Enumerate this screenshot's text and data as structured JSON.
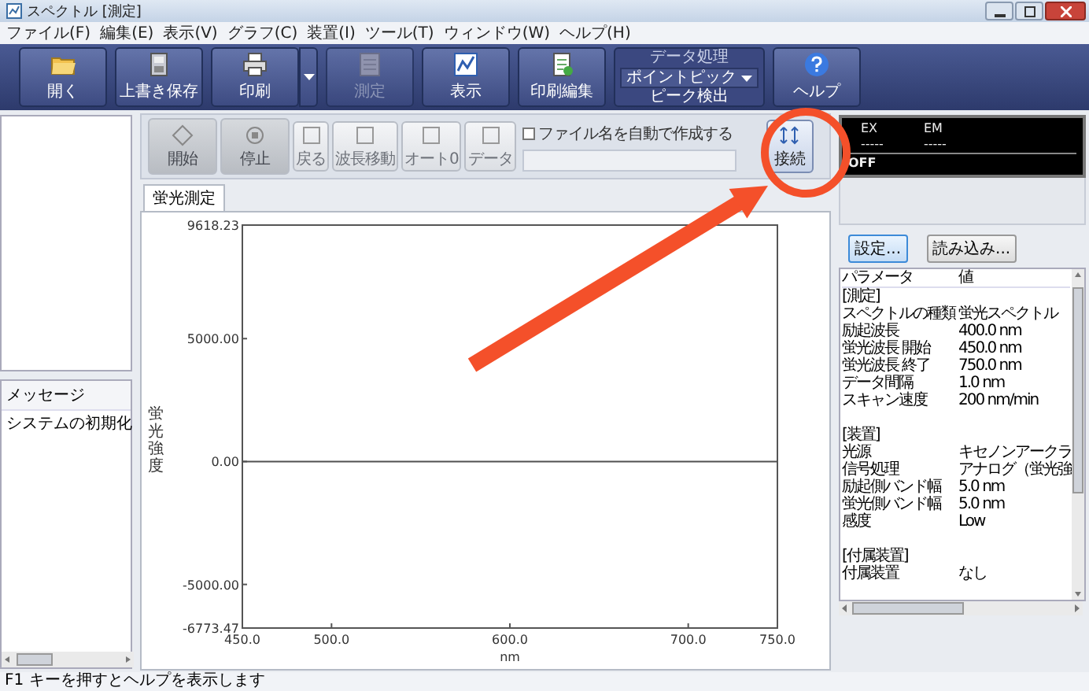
{
  "window": {
    "title": "スペクトル [測定]"
  },
  "menu": [
    "ファイル(F)",
    "編集(E)",
    "表示(V)",
    "グラフ(C)",
    "装置(I)",
    "ツール(T)",
    "ウィンドウ(W)",
    "ヘルプ(H)"
  ],
  "toolbar": [
    {
      "label": "開く",
      "disabled": false,
      "dropdown": false
    },
    {
      "label": "上書き保存",
      "disabled": false,
      "dropdown": false
    },
    {
      "label": "印刷",
      "disabled": false,
      "dropdown": true
    },
    {
      "label": "測定",
      "disabled": true,
      "dropdown": false
    },
    {
      "label": "表示",
      "disabled": false,
      "dropdown": false
    },
    {
      "label": "印刷編集",
      "disabled": false,
      "dropdown": false
    }
  ],
  "data_processing": {
    "title": "データ処理",
    "option": "ポイントピック",
    "button": "ピーク検出"
  },
  "help_button": {
    "label": "ヘルプ"
  },
  "measure_toolbar": [
    {
      "label": "開始",
      "kind": "large",
      "disabled": true
    },
    {
      "label": "停止",
      "kind": "large",
      "disabled": true
    },
    {
      "label": "戻る",
      "kind": "small",
      "disabled": true
    },
    {
      "label": "波長移動",
      "kind": "small",
      "disabled": true
    },
    {
      "label": "オート0",
      "kind": "small",
      "disabled": true
    },
    {
      "label": "データ",
      "kind": "small",
      "disabled": true
    }
  ],
  "auto_filename": {
    "label": "ファイル名を自動で作成する",
    "checked": false
  },
  "connect_button": {
    "label": "接続",
    "disabled": false
  },
  "tabs": [
    {
      "label": "蛍光測定",
      "selected": true
    }
  ],
  "chart": {
    "chart_data": {
      "type": "line",
      "xlabel": "nm",
      "ylabel": "蛍光強度",
      "x": [
        450,
        750
      ],
      "series": [
        {
          "color": "#505050",
          "values": [
            0,
            0
          ]
        }
      ],
      "xlim": [
        450,
        750
      ],
      "ylim": [
        -6773.47,
        9618.23
      ],
      "xticks": [
        {
          "value": 450,
          "label": "450.0"
        },
        {
          "value": 500,
          "label": "500.0"
        },
        {
          "value": 600,
          "label": "600.0"
        },
        {
          "value": 700,
          "label": "700.0"
        },
        {
          "value": 750,
          "label": "750.0"
        }
      ],
      "yticks": [
        {
          "value": -6773.47,
          "label": "-6773.47"
        },
        {
          "value": -5000,
          "label": "-5000.00"
        },
        {
          "value": 0,
          "label": "0.00"
        },
        {
          "value": 5000,
          "label": "5000.00"
        },
        {
          "value": 9618.23,
          "label": "9618.23"
        }
      ]
    }
  },
  "messages": {
    "header": "メッセージ",
    "items": [
      "システムの初期化"
    ]
  },
  "monitor": {
    "ex_label": "EX",
    "em_label": "EM",
    "ex_value": "-----",
    "em_value": "-----",
    "status": "OFF"
  },
  "param_buttons": [
    {
      "label": "設定...",
      "focused": true
    },
    {
      "label": "読み込み...",
      "focused": false
    }
  ],
  "parameters": {
    "columns": [
      "パラメータ",
      "値"
    ],
    "rows": [
      {
        "kind": "section",
        "name": "[測定]"
      },
      {
        "kind": "param",
        "name": "スペクトルの種類",
        "value": "蛍光スペクトル"
      },
      {
        "kind": "param",
        "name": "励起波長",
        "value": "400.0 nm"
      },
      {
        "kind": "param",
        "name": "蛍光波長 開始",
        "value": "450.0 nm"
      },
      {
        "kind": "param",
        "name": "蛍光波長 終了",
        "value": "750.0 nm"
      },
      {
        "kind": "param",
        "name": "データ間隔",
        "value": "1.0 nm"
      },
      {
        "kind": "param",
        "name": "スキャン速度",
        "value": "200 nm/min"
      },
      {
        "kind": "blank"
      },
      {
        "kind": "section",
        "name": "[装置]"
      },
      {
        "kind": "param",
        "name": "光源",
        "value": "キセノンアークラ"
      },
      {
        "kind": "param",
        "name": "信号処理",
        "value": "アナログ（蛍光強"
      },
      {
        "kind": "param",
        "name": "励起側バンド幅",
        "value": "5.0 nm"
      },
      {
        "kind": "param",
        "name": "蛍光側バンド幅",
        "value": "5.0 nm"
      },
      {
        "kind": "param",
        "name": "感度",
        "value": "Low"
      },
      {
        "kind": "blank"
      },
      {
        "kind": "section",
        "name": "[付属装置]"
      },
      {
        "kind": "param",
        "name": "付属装置",
        "value": "なし"
      }
    ]
  },
  "status_bar": "F1 キーを押すとヘルプを表示します"
}
